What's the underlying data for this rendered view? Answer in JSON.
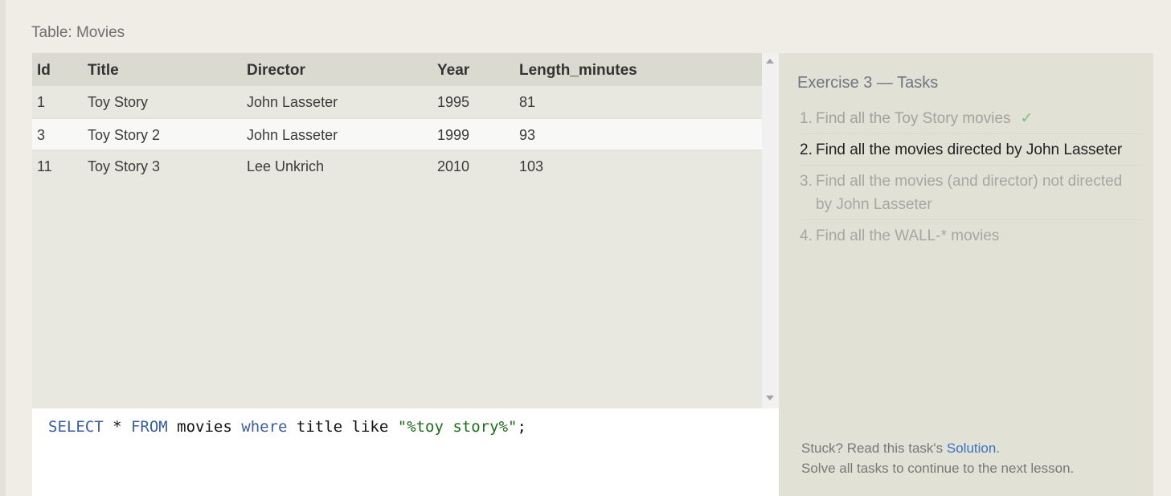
{
  "table": {
    "caption": "Table: Movies",
    "columns": [
      "Id",
      "Title",
      "Director",
      "Year",
      "Length_minutes"
    ],
    "rows": [
      [
        "1",
        "Toy Story",
        "John Lasseter",
        "1995",
        "81"
      ],
      [
        "3",
        "Toy Story 2",
        "John Lasseter",
        "1999",
        "93"
      ],
      [
        "11",
        "Toy Story 3",
        "Lee Unkrich",
        "2010",
        "103"
      ]
    ]
  },
  "editor": {
    "tokens": [
      {
        "text": "SELECT",
        "kind": "kw"
      },
      {
        "text": " * ",
        "kind": "plain"
      },
      {
        "text": "FROM",
        "kind": "kw"
      },
      {
        "text": " movies ",
        "kind": "plain"
      },
      {
        "text": "where",
        "kind": "kw"
      },
      {
        "text": " title like ",
        "kind": "plain"
      },
      {
        "text": "\"%toy story%\"",
        "kind": "str"
      },
      {
        "text": ";",
        "kind": "plain"
      }
    ]
  },
  "tasks": {
    "title": "Exercise 3 — Tasks",
    "items": [
      {
        "num": "1.",
        "text": "Find all the Toy Story movies",
        "check": "✓",
        "state": "done"
      },
      {
        "num": "2.",
        "text": "Find all the movies directed by John Lasseter",
        "state": "current"
      },
      {
        "num": "3.",
        "text": "Find all the movies (and director) not directed by John Lasseter",
        "state": "future"
      },
      {
        "num": "4.",
        "text": "Find all the WALL-* movies",
        "state": "future"
      }
    ]
  },
  "help": {
    "stuck_prefix": "Stuck? Read this task's ",
    "solution_link": "Solution",
    "stuck_suffix": ".",
    "continue_text": "Solve all tasks to continue to the next lesson."
  },
  "colors": {
    "keyword": "#3b5e9e",
    "string": "#1a6e1a",
    "link": "#3b72c2",
    "check": "#7cc47c"
  }
}
